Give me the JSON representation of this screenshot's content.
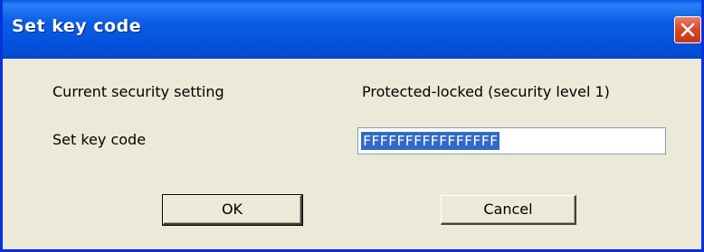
{
  "window": {
    "title": "Set key code"
  },
  "fields": {
    "security_label": "Current security setting",
    "security_value": "Protected-locked (security level 1)",
    "keycode_label": "Set key code",
    "keycode_value": "FFFFFFFFFFFFFFFF"
  },
  "buttons": {
    "ok_label": "OK",
    "cancel_label": "Cancel"
  },
  "icons": {
    "close": "close-icon"
  },
  "colors": {
    "titlebar": "#0453dd",
    "close_button": "#d9492a",
    "dialog_background": "#ece9d8",
    "selection": "#316ac5"
  }
}
